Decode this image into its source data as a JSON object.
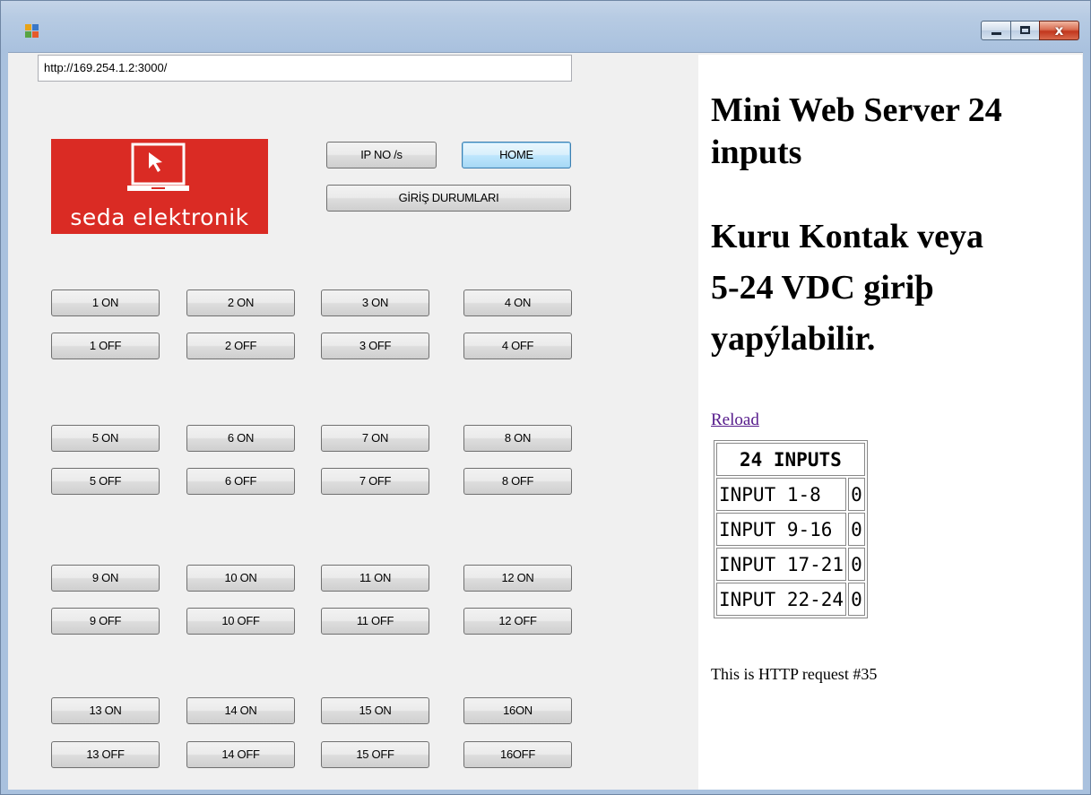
{
  "window": {
    "buttons": {
      "minimize": "minimize",
      "maximize": "maximize",
      "close": "x"
    },
    "app_icon_colors": [
      "#e8a317",
      "#3a78c8",
      "#58a341",
      "#e55b2b"
    ]
  },
  "url_bar": {
    "value": "http://169.254.1.2:3000/"
  },
  "logo": {
    "text": "seda elektronik",
    "bg": "#da2b24"
  },
  "top_buttons": {
    "ip": "IP NO /s",
    "home": "HOME",
    "inputs_status": "GİRİŞ DURUMLARI"
  },
  "relay_buttons": [
    [
      "1 ON",
      "2 ON",
      "3 ON",
      "4 ON"
    ],
    [
      "1 OFF",
      "2 OFF",
      "3 OFF",
      "4 OFF"
    ],
    [
      "5 ON",
      "6 ON",
      "7 ON",
      "8 ON"
    ],
    [
      "5 OFF",
      "6 OFF",
      "7 OFF",
      "8 OFF"
    ],
    [
      "9 ON",
      "10 ON",
      "11 ON",
      "12 ON"
    ],
    [
      "9 OFF",
      "10 OFF",
      "11 OFF",
      "12 OFF"
    ],
    [
      "13 ON",
      "14 ON",
      "15 ON",
      "16ON"
    ],
    [
      "13 OFF",
      "14 OFF",
      "15 OFF",
      "16OFF"
    ]
  ],
  "browser": {
    "heading1_line1": "Mini Web Server 24",
    "heading1_line2": "inputs",
    "heading2_line1": "Kuru Kontak veya",
    "heading2_line2": "5-24 VDC giriþ",
    "heading2_line3": "yapýlabilir.",
    "reload": "Reload",
    "table_title": "24 INPUTS",
    "rows": [
      {
        "label": "INPUT 1-8",
        "value": "0"
      },
      {
        "label": "INPUT 9-16",
        "value": "0"
      },
      {
        "label": "INPUT 17-21",
        "value": "0"
      },
      {
        "label": "INPUT 22-24",
        "value": "0"
      }
    ],
    "request_text": "This is HTTP request #35"
  }
}
